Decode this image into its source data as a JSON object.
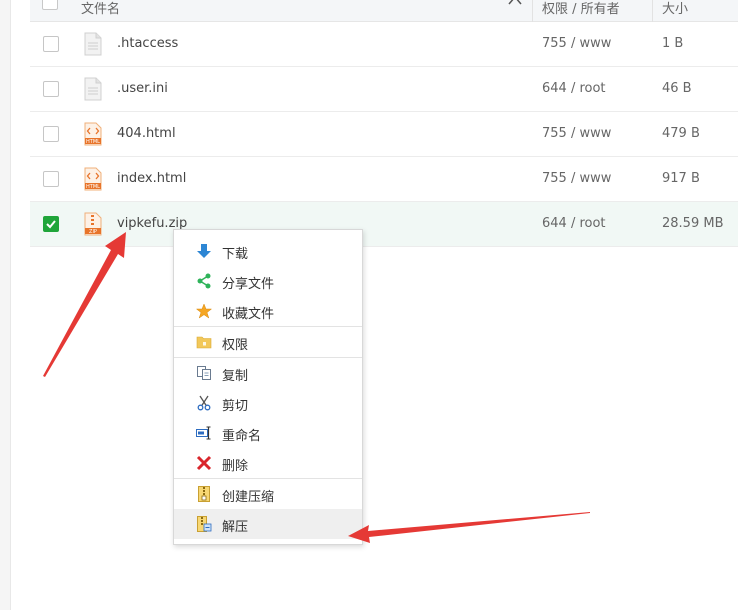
{
  "header": {
    "col_name": "文件名",
    "col_perm": "权限 / 所有者",
    "col_size": "大小",
    "sort_glyph": "^"
  },
  "files": [
    {
      "name": ".htaccess",
      "perm": "755 / www",
      "size": "1 B",
      "icon": "text-file-icon",
      "checked": false
    },
    {
      "name": ".user.ini",
      "perm": "644 / root",
      "size": "46 B",
      "icon": "text-file-icon",
      "checked": false
    },
    {
      "name": "404.html",
      "perm": "755 / www",
      "size": "479 B",
      "icon": "html-file-icon",
      "checked": false
    },
    {
      "name": "index.html",
      "perm": "755 / www",
      "size": "917 B",
      "icon": "html-file-icon",
      "checked": false
    },
    {
      "name": "vipkefu.zip",
      "perm": "644 / root",
      "size": "28.59 MB",
      "icon": "zip-file-icon",
      "checked": true
    }
  ],
  "file_icon_labels": {
    "html": "HTML",
    "zip": "ZIP"
  },
  "context_menu": {
    "download": "下载",
    "share": "分享文件",
    "favorite": "收藏文件",
    "permission": "权限",
    "copy": "复制",
    "cut": "剪切",
    "rename": "重命名",
    "delete": "删除",
    "compress": "创建压缩",
    "extract": "解压"
  },
  "colors": {
    "accent_green": "#20a53a",
    "annotation_red": "#e53935",
    "delete_red": "#d9262c"
  }
}
